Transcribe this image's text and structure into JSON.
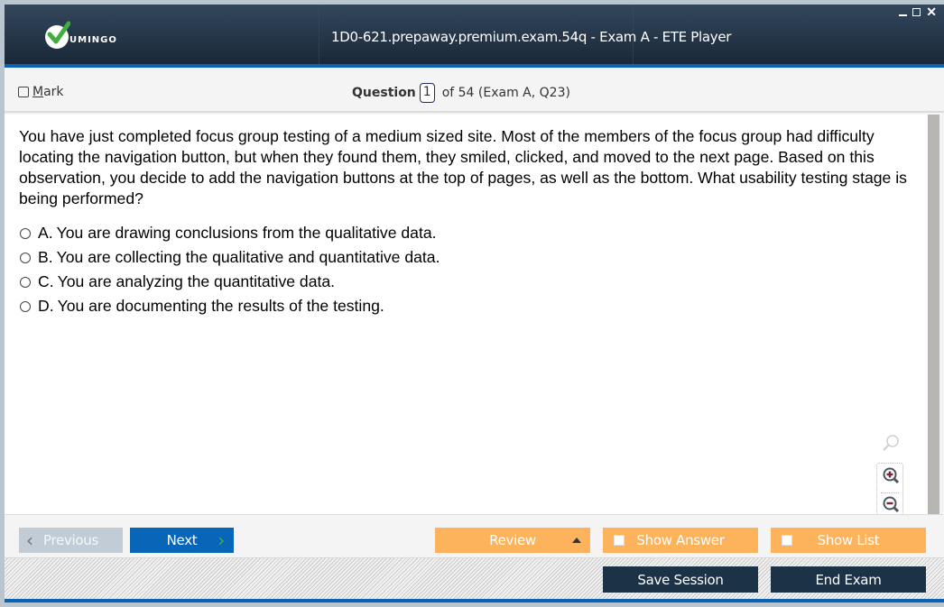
{
  "app": {
    "logo_text": "UMINGO",
    "window_title": "1D0-621.prepaway.premium.exam.54q - Exam A - ETE Player",
    "controls": {
      "minimize": "minimize-icon",
      "maximize": "maximize-icon",
      "close": "close-icon"
    }
  },
  "header": {
    "mark_label_first": "M",
    "mark_label_rest": "ark",
    "mark_checked": false,
    "question_label": "Question",
    "question_number": "1",
    "question_of": "of 54 (Exam A, Q23)"
  },
  "question": {
    "text": "You have just completed focus group testing of a medium sized site. Most of the members of the focus group had difficulty locating the navigation button, but when they found them, they smiled, clicked, and moved to the next page. Based on this observation, you decide to add the navigation buttons at the top of pages, as well as the bottom. What usability testing stage is being performed?",
    "options": [
      {
        "letter": "A.",
        "text": "You are drawing conclusions from the qualitative data.",
        "selected": false
      },
      {
        "letter": "B.",
        "text": "You are collecting the qualitative and quantitative data.",
        "selected": false
      },
      {
        "letter": "C.",
        "text": "You are analyzing the quantitative data.",
        "selected": false
      },
      {
        "letter": "D.",
        "text": "You are documenting the results of the testing.",
        "selected": false
      }
    ]
  },
  "zoom_tools": {
    "reset": "zoom-reset-icon",
    "zoom_in": "zoom-in-icon",
    "zoom_out": "zoom-out-icon"
  },
  "nav": {
    "previous_label": "Previous",
    "next_label": "Next",
    "review_label": "Review",
    "show_answer_label": "Show Answer",
    "show_list_label": "Show List",
    "show_answer_checked": false,
    "show_list_checked": false
  },
  "footer": {
    "save_session_label": "Save Session",
    "end_exam_label": "End Exam"
  },
  "colors": {
    "title_bar": "#1a2838",
    "accent_blue": "#0a63b3",
    "next_button": "#0865b7",
    "orange_button": "#fdb35c",
    "dark_button": "#1c3247",
    "previous_button": "#c1ccd7",
    "logo_check": "#3fae3f"
  }
}
